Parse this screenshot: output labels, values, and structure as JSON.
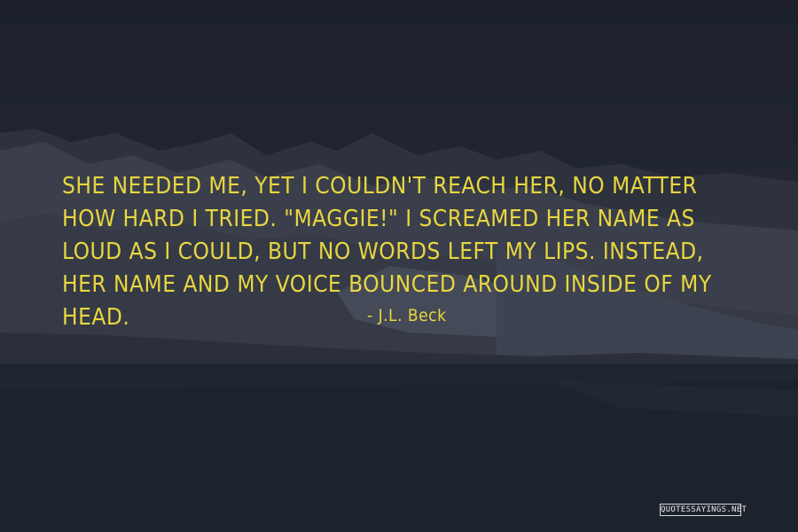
{
  "quote": {
    "text": "She needed me, yet I couldn't reach her, no matter how hard I tried. \"Maggie!\" I screamed her name as loud as I could, but no words left my lips. Instead, her name and my voice bounced around inside of my head.",
    "author": "- J.L. Beck"
  },
  "watermark": "QUOTESSAYINGS.NET",
  "colors": {
    "text": "#e8d640",
    "sky": "#1c212c",
    "snow": "#3a404c",
    "water": "#20262f"
  }
}
